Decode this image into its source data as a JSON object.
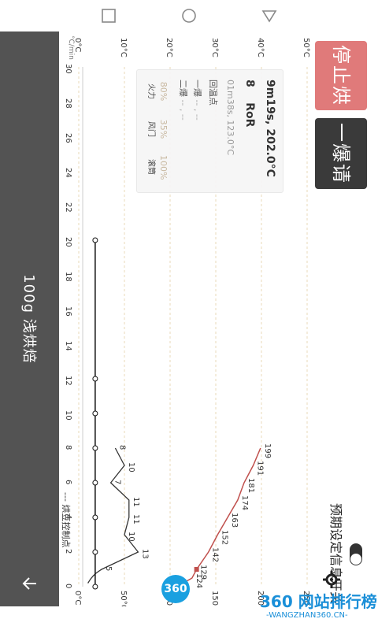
{
  "nav": {
    "square": "recent-apps-icon",
    "circle": "home-icon",
    "triangle": "back-icon"
  },
  "title": "100g 浅烘焙",
  "buttons": {
    "stop": "停止烘豆",
    "first_crack": "一爆请按"
  },
  "info": {
    "time_temp": "9m19s, 202.0°C",
    "ror_label": "RoR",
    "ror_value": "8",
    "return_point": "01m38s, 123.0°C",
    "return_label": "回温点",
    "first_crack_label": "一爆",
    "second_crack_label": "二爆",
    "first_crack_value": "-- , --",
    "second_crack_value": "-- , --",
    "controls": [
      {
        "label": "火力",
        "value": "80%"
      },
      {
        "label": "风门",
        "value": "35%"
      },
      {
        "label": "滚筒",
        "value": "100%"
      }
    ]
  },
  "legend": "--- 烘豆控制点",
  "bottom": {
    "info_switch_label": "预期设定信息开关"
  },
  "watermark": {
    "text": "360 网站排行榜",
    "sub": "-WANGZHAN360.CN-"
  },
  "chart_data": {
    "type": "line",
    "x_axis": {
      "label": "",
      "ticks": [
        0,
        2,
        4,
        6,
        8,
        10,
        12,
        14,
        16,
        18,
        20,
        22,
        24,
        26,
        28,
        30
      ]
    },
    "y_axis_temp": {
      "ticks": [
        "0°C",
        "50°C",
        "100°C",
        "150°C",
        "200°C",
        "250°C"
      ]
    },
    "y_axis_ror": {
      "unit": "°C/min",
      "ticks": [
        "0°C",
        "10°C",
        "20°C",
        "30°C",
        "40°C",
        "50°C"
      ]
    },
    "bean_temp_labels": [
      {
        "x": 0.5,
        "v": 124
      },
      {
        "x": 1.0,
        "v": 129
      },
      {
        "x": 2.0,
        "v": 142
      },
      {
        "x": 3.0,
        "v": 152
      },
      {
        "x": 4.0,
        "v": 163
      },
      {
        "x": 5.0,
        "v": 174
      },
      {
        "x": 6.0,
        "v": 181
      },
      {
        "x": 7.0,
        "v": 191
      },
      {
        "x": 8.0,
        "v": 199
      }
    ],
    "ror_labels": [
      {
        "x": 1.0,
        "v": 5
      },
      {
        "x": 2.0,
        "v": 13
      },
      {
        "x": 3.0,
        "v": 10
      },
      {
        "x": 4.0,
        "v": 11
      },
      {
        "x": 5.0,
        "v": 11
      },
      {
        "x": 6.0,
        "v": 7
      },
      {
        "x": 7.0,
        "v": 10
      },
      {
        "x": 8.0,
        "v": 8
      }
    ],
    "control_line_points": [
      0,
      2,
      4,
      6,
      8,
      10,
      12,
      20
    ],
    "colors": {
      "bean": "#c0504d",
      "ror": "#333333",
      "control": "#111111",
      "grid": "#e8d8b8"
    }
  }
}
